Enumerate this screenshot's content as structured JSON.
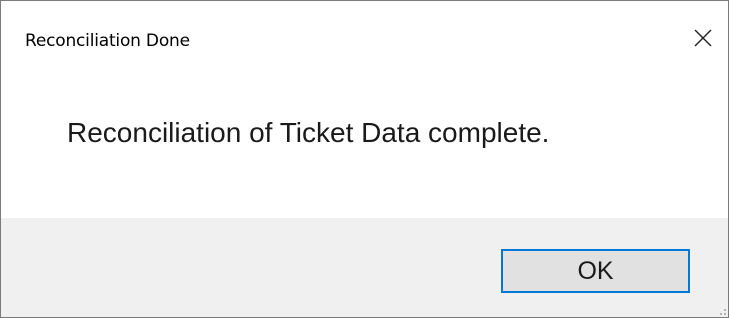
{
  "dialog": {
    "title": "Reconciliation Done",
    "close_glyph": "✕",
    "close_icon": "close-icon",
    "message": "Reconciliation of Ticket Data complete.",
    "ok_label": "OK"
  },
  "colors": {
    "button_border_accent": "#0078d7",
    "button_area_bg": "#f0f0f0",
    "button_bg": "#e1e1e1"
  }
}
